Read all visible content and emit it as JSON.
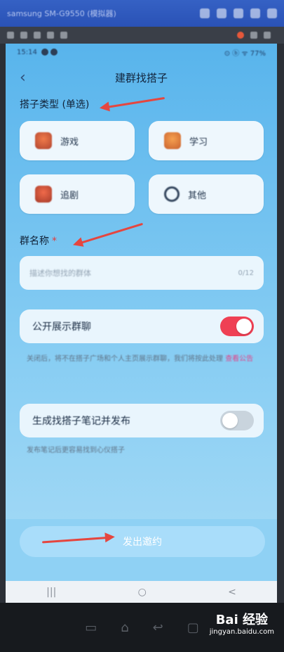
{
  "window": {
    "title": "samsung SM-G9550 (模拟器)",
    "icons": [
      "camera-icon",
      "settings-icon",
      "pin-icon",
      "minimize-icon",
      "close-icon"
    ]
  },
  "status_bar": {
    "time": "15:14",
    "right": "⊙ ⓑ ᯤ 77%"
  },
  "header": {
    "back_icon": "back-chevron-icon",
    "title": "建群找搭子"
  },
  "type_section": {
    "label": "搭子类型 (单选)",
    "options": [
      {
        "label": "游戏",
        "icon": "game-icon"
      },
      {
        "label": "学习",
        "icon": "study-icon"
      },
      {
        "label": "追剧",
        "icon": "drama-icon"
      },
      {
        "label": "其他",
        "icon": "circle-icon"
      }
    ]
  },
  "name_section": {
    "label": "群名称",
    "required_mark": "*",
    "placeholder": "描述你想找的群体",
    "counter": "0/12"
  },
  "public_toggle": {
    "label": "公开展示群聊",
    "on": true,
    "hint": "关闭后，将不在搭子广场和个人主页展示群聊，我们将按此处理",
    "hint_link": "查看公告"
  },
  "note_toggle": {
    "label": "生成找搭子笔记并发布",
    "on": false,
    "hint": "发布笔记后更容易找到心仪搭子"
  },
  "submit_label": "发出邀约",
  "android_nav": [
    "|||",
    "○",
    "<"
  ],
  "host_nav": [
    "▭",
    "⌂",
    "↩",
    "▢"
  ],
  "watermark": {
    "main": "Bai 经验",
    "sub": "jingyan.baidu.com"
  },
  "colors": {
    "accent_red": "#ef4054",
    "arrow_red": "#e5463f",
    "link_pink": "#e0458a"
  }
}
